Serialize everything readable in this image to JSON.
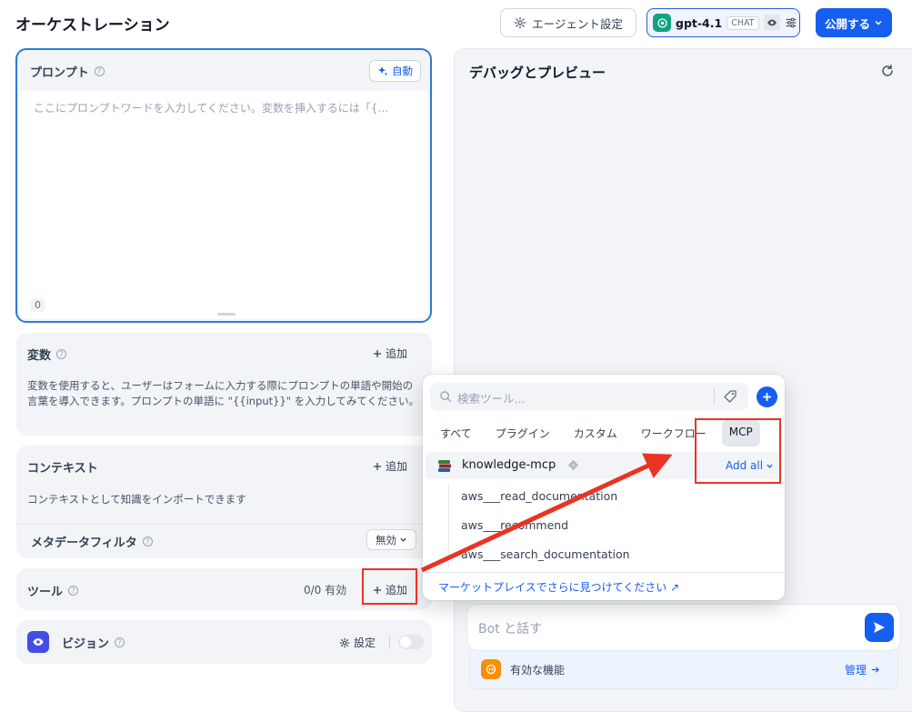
{
  "header": {
    "title": "オーケストレーション",
    "agent_settings": "エージェント設定",
    "model_name": "gpt-4.1",
    "model_badge": "CHAT",
    "publish": "公開する"
  },
  "prompt": {
    "label": "プロンプト",
    "help": "?",
    "auto": "自動",
    "placeholder": "ここにプロンプトワードを入力してください。変数を挿入するには「{...",
    "count": "0"
  },
  "variables": {
    "label": "変数",
    "add": "追加",
    "description": "変数を使用すると、ユーザーはフォームに入力する際にプロンプトの単語や開始の言葉を導入できます。プロンプトの単語に \"{{input}}\" を入力してみてください。"
  },
  "context": {
    "label": "コンテキスト",
    "add": "追加",
    "description": "コンテキストとして知識をインポートできます",
    "metadata_filter": "メタデータフィルタ",
    "metadata_value": "無効"
  },
  "tools": {
    "label": "ツール",
    "status": "0/0 有効",
    "add": "追加"
  },
  "vision": {
    "label": "ビジョン",
    "settings": "設定"
  },
  "debug": {
    "title": "デバッグとプレビュー",
    "chat_placeholder": "Bot と話す",
    "features_label": "有効な機能",
    "manage": "管理"
  },
  "tool_picker": {
    "search_placeholder": "検索ツール...",
    "tabs": [
      "すべて",
      "プラグイン",
      "カスタム",
      "ワークフロー",
      "MCP"
    ],
    "active_tab": "MCP",
    "provider": "knowledge-mcp",
    "add_all": "Add all",
    "tools": [
      "aws___read_documentation",
      "aws___recommend",
      "aws___search_documentation"
    ],
    "marketplace": "マーケットプレイスでさらに見つけてください ↗"
  },
  "colors": {
    "accent": "#155eef",
    "annotation": "#ea3323",
    "vision": "#444ce7",
    "features": "#f79009"
  }
}
